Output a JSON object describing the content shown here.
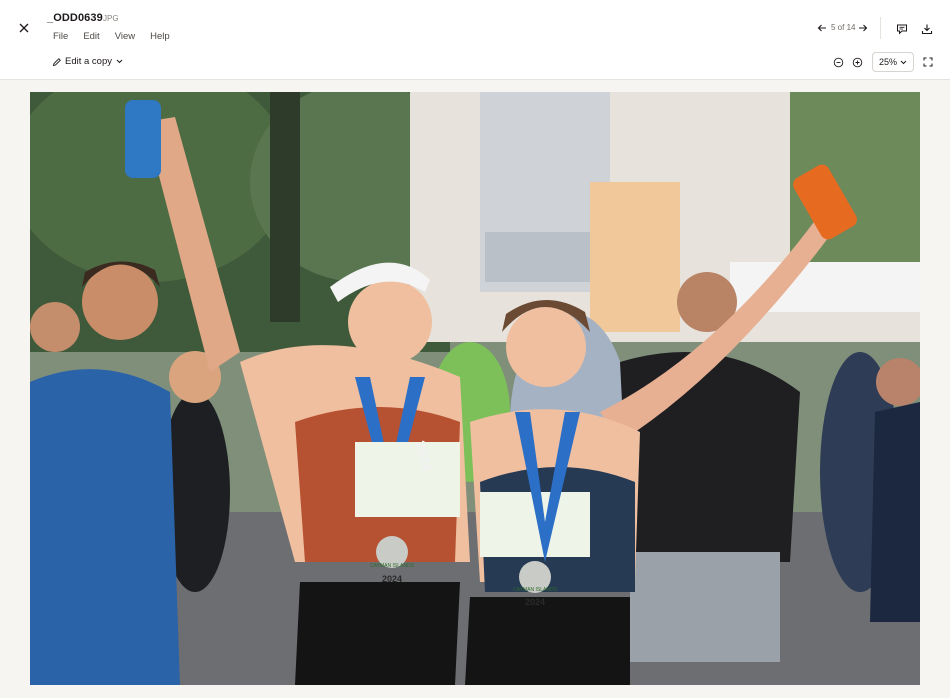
{
  "header": {
    "file_name": "_ODD0639",
    "file_ext": "JPG",
    "menu": [
      {
        "label": "File"
      },
      {
        "label": "Edit"
      },
      {
        "label": "View"
      },
      {
        "label": "Help"
      }
    ],
    "edit_copy_label": "Edit a copy",
    "page_counter": "5 of 14",
    "zoom_value": "25%"
  },
  "icons": {
    "close": "close-icon",
    "prev": "arrow-left-icon",
    "next": "arrow-right-icon",
    "comment": "comment-icon",
    "download": "download-icon",
    "zoom_out": "zoom-out-icon",
    "zoom_in": "zoom-in-icon",
    "fullscreen": "fullscreen-icon",
    "pencil": "pencil-icon",
    "chevron": "chevron-down-icon"
  },
  "photo": {
    "medal_text_1": "CAYMAN ISLANDS",
    "medal_text_2": "2024",
    "ribbon_text": "2024"
  },
  "colors": {
    "background": "#f7f5f2",
    "topbar": "#ffffff",
    "border": "#e6e3df",
    "text": "#1e1919"
  }
}
